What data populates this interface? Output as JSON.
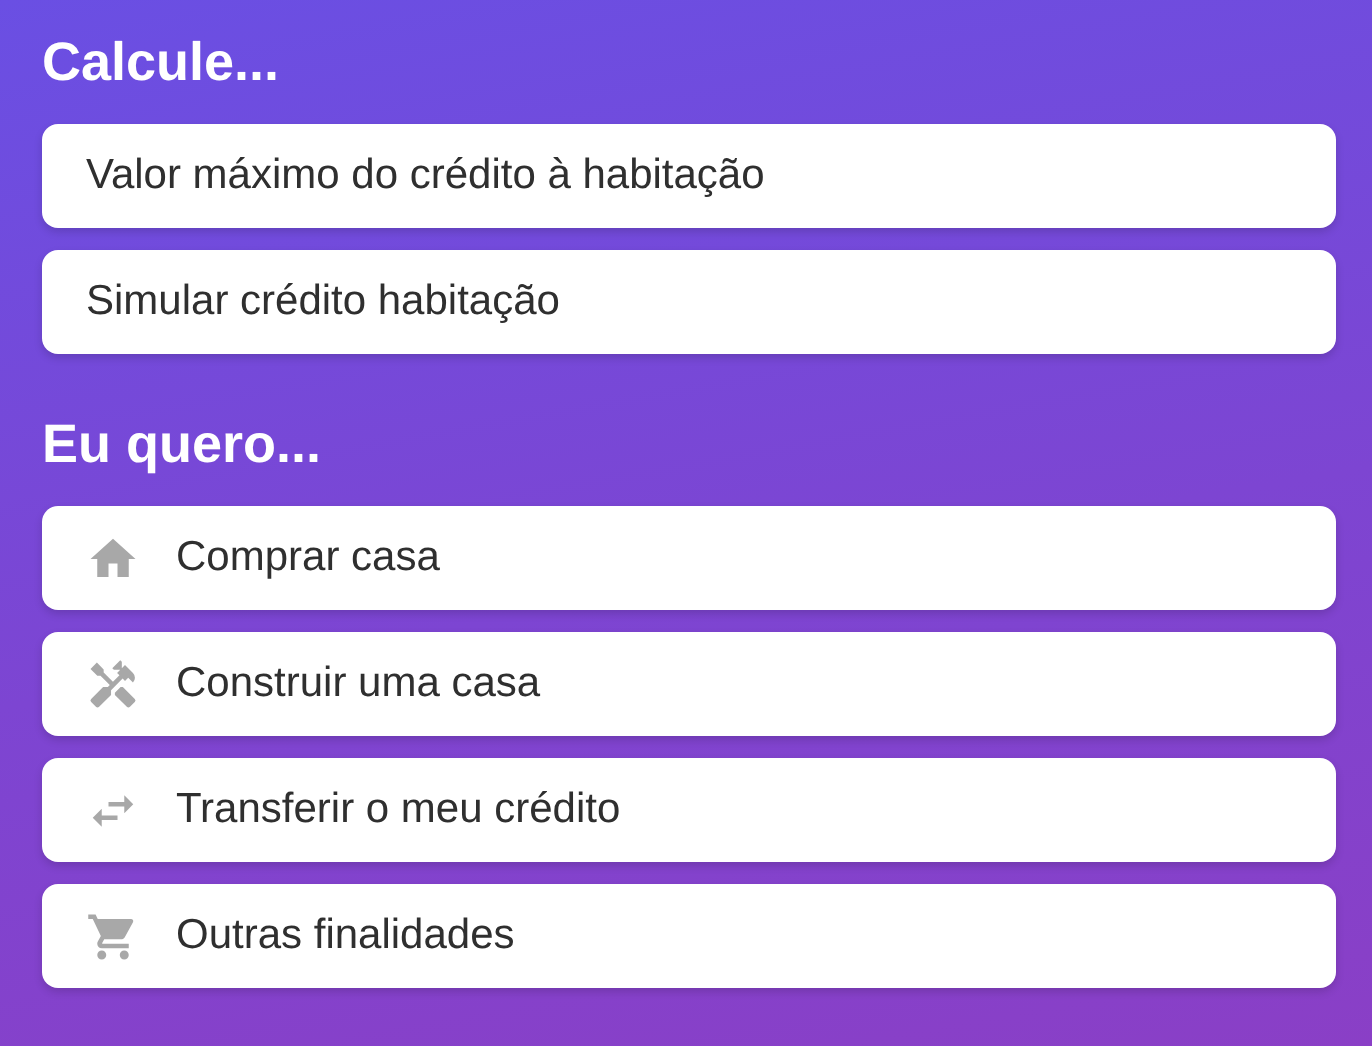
{
  "sections": [
    {
      "title": "Calcule...",
      "items": [
        {
          "label": "Valor máximo do crédito à habitação"
        },
        {
          "label": "Simular crédito habitação"
        }
      ]
    },
    {
      "title": "Eu quero...",
      "items": [
        {
          "label": "Comprar casa",
          "kind": "house"
        },
        {
          "label": "Construir uma casa",
          "kind": "tools"
        },
        {
          "label": "Transferir o meu crédito",
          "kind": "transfer"
        },
        {
          "label": "Outras finalidades",
          "kind": "cart"
        }
      ]
    }
  ]
}
